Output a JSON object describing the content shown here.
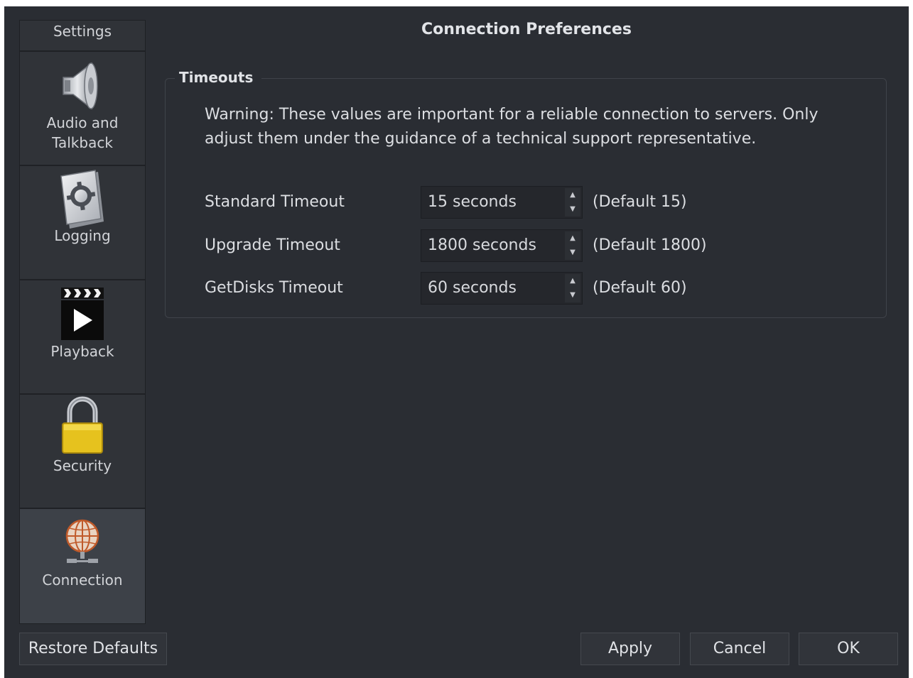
{
  "sidebar": {
    "title": "Settings",
    "items": [
      {
        "label": "Audio and\nTalkback",
        "icon": "speaker-icon"
      },
      {
        "label": "Logging",
        "icon": "gear-document-icon"
      },
      {
        "label": "Playback",
        "icon": "clapperboard-play-icon"
      },
      {
        "label": "Security",
        "icon": "padlock-icon"
      },
      {
        "label": "Connection",
        "icon": "globe-network-icon",
        "selected": true
      }
    ]
  },
  "main": {
    "title": "Connection Preferences",
    "group_title": "Timeouts",
    "warning": "Warning: These values are important for a reliable connection to servers. Only adjust them under the guidance of a technical support representative.",
    "rows": [
      {
        "label": "Standard Timeout",
        "value": "15 seconds",
        "default": "(Default 15)"
      },
      {
        "label": "Upgrade Timeout",
        "value": "1800 seconds",
        "default": "(Default 1800)"
      },
      {
        "label": "GetDisks Timeout",
        "value": "60 seconds",
        "default": "(Default 60)"
      }
    ]
  },
  "buttons": {
    "restore_defaults": "Restore Defaults",
    "apply": "Apply",
    "cancel": "Cancel",
    "ok": "OK"
  },
  "colors": {
    "background": "#2a2d33",
    "sidebar": "#303338",
    "selected": "#3d4148",
    "lock": "#e6c21e"
  }
}
